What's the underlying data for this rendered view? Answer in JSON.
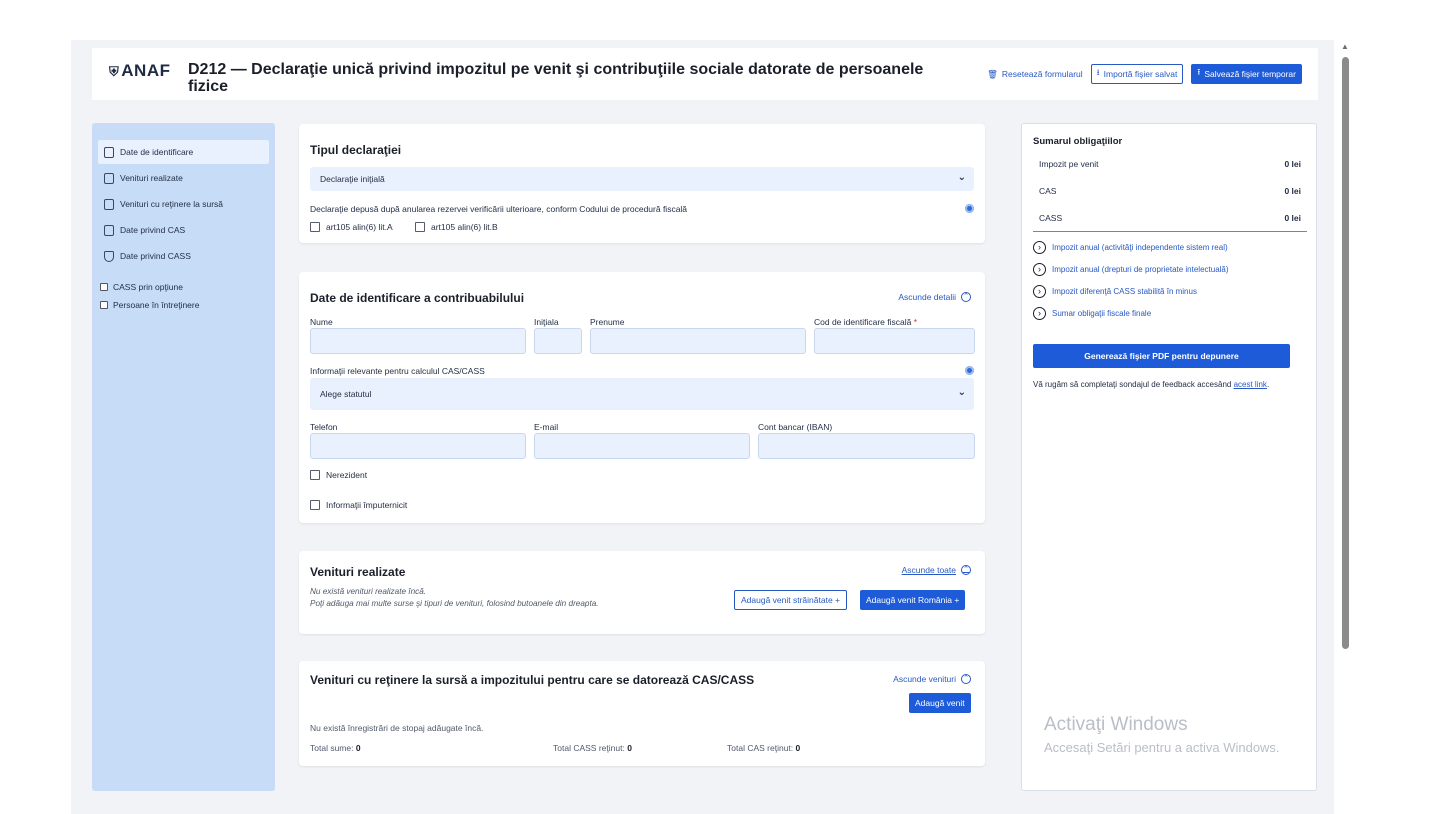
{
  "header": {
    "logo": "ANAF",
    "title": "D212 — Declaraţie unică privind impozitul pe venit şi contribuţiile sociale datorate de persoanele fizice",
    "reset_label": "Resetează formularul",
    "import_label": "Importă fişier salvat",
    "save_label": "Salvează fişier temporar"
  },
  "sidebar": {
    "items": [
      {
        "label": "Date de identificare",
        "icon": "document-icon"
      },
      {
        "label": "Venituri realizate",
        "icon": "copy-icon"
      },
      {
        "label": "Venituri cu reţinere la sursă",
        "icon": "copy-icon"
      },
      {
        "label": "Date privind CAS",
        "icon": "calculator-icon"
      },
      {
        "label": "Date privind CASS",
        "icon": "shield-icon"
      }
    ],
    "checks": [
      {
        "label": "CASS prin opţiune"
      },
      {
        "label": "Persoane în întreţinere"
      }
    ]
  },
  "tip": {
    "title": "Tipul declaraţiei",
    "select_value": "Declaraţie iniţială",
    "note": "Declaraţie depusă după anularea rezervei verificării ulterioare, conform Codului de procedură fiscală",
    "cb1": "art105 alin(6) lit.A",
    "cb2": "art105 alin(6) lit.B"
  },
  "identificare": {
    "title": "Date de identificare a contribuabilului",
    "toggle": "Ascunde detalii",
    "nume": "Nume",
    "initiala": "Iniţiala",
    "prenume": "Prenume",
    "cif": "Cod de identificare fiscală",
    "req": "*",
    "info_label": "Informaţii relevante pentru calculul CAS/CASS",
    "status_placeholder": "Alege statutul",
    "telefon": "Telefon",
    "email": "E-mail",
    "iban": "Cont bancar (IBAN)",
    "nerezident": "Nerezident",
    "imputernicit": "Informaţii împuternicit"
  },
  "venituri": {
    "title": "Venituri realizate",
    "toggle": "Ascunde toate",
    "empty1": "Nu există venituri realizate încă.",
    "empty2": "Poţi adăuga mai multe surse şi tipuri de venituri, folosind butoanele din dreapta.",
    "btn_strain": "Adaugă venit străinătate +",
    "btn_ro": "Adaugă venit România +"
  },
  "retinere": {
    "title": "Venituri cu reţinere la sursă a impozitului pentru care se datorează CAS/CASS",
    "toggle": "Ascunde venituri",
    "btn": "Adaugă venit",
    "empty": "Nu există înregistrări de stopaj adăugate încă.",
    "total_sume_label": "Total sume:",
    "total_sume": "0",
    "total_cass_label": "Total CASS reţinut:",
    "total_cass": "0",
    "total_cas_label": "Total CAS reţinut:",
    "total_cas": "0"
  },
  "summary": {
    "title": "Sumarul obligaţiilor",
    "rows": [
      {
        "label": "Impozit pe venit",
        "value": "0 lei"
      },
      {
        "label": "CAS",
        "value": "0 lei"
      },
      {
        "label": "CASS",
        "value": "0 lei"
      }
    ],
    "links": [
      "Impozit anual (activităţi independente sistem real)",
      "Impozit anual (drepturi de proprietate intelectuală)",
      "Impozit diferenţă CASS stabilită în minus",
      "Sumar obligaţii fiscale finale"
    ],
    "generate": "Generează fişier PDF pentru depunere",
    "feedback_text": "Vă rugăm să completaţi sondajul de feedback accesând ",
    "feedback_link": "acest link",
    "feedback_end": "."
  },
  "watermark": {
    "line1": "Activaţi Windows",
    "line2": "Accesaţi Setări pentru a activa Windows."
  }
}
